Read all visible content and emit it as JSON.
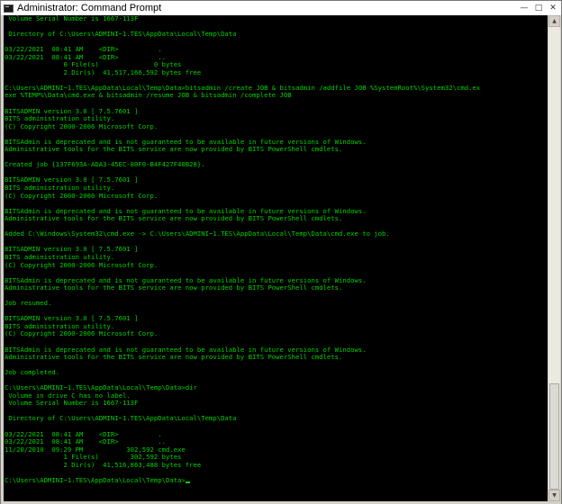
{
  "window": {
    "title": "Administrator: Command Prompt",
    "minimize_glyph": "—",
    "maximize_glyph": "□",
    "close_glyph": "✕"
  },
  "console": {
    "text_color": "#00d200",
    "background_color": "#000000",
    "lines": [
      " Volume Serial Number is 1667-113F",
      "",
      " Directory of C:\\Users\\ADMINI~1.TES\\AppData\\Local\\Temp\\Data",
      "",
      "03/22/2021  08:41 AM    <DIR>          .",
      "03/22/2021  08:41 AM    <DIR>          ..",
      "               0 File(s)              0 bytes",
      "               2 Dir(s)  41,517,166,592 bytes free",
      "",
      "C:\\Users\\ADMINI~1.TES\\AppData\\Local\\Temp\\Data>bitsadmin /create JOB & bitsadmin /addfile JOB %SystemRoot%\\System32\\cmd.ex",
      "exe %TEMP%\\Data\\cmd.exe & bitsadmin /resume JOB & bitsadmin /complete JOB",
      "",
      "BITSADMIN version 3.0 [ 7.5.7601 ]",
      "BITS administration utility.",
      "(C) Copyright 2000-2006 Microsoft Corp.",
      "",
      "BITSAdmin is deprecated and is not guaranteed to be available in future versions of Windows.",
      "Administrative tools for the BITS service are now provided by BITS PowerShell cmdlets.",
      "",
      "Created job {137F693A-ADA3-45EC-80F0-B4F427F40B28}.",
      "",
      "BITSADMIN version 3.0 [ 7.5.7601 ]",
      "BITS administration utility.",
      "(C) Copyright 2000-2006 Microsoft Corp.",
      "",
      "BITSAdmin is deprecated and is not guaranteed to be available in future versions of Windows.",
      "Administrative tools for the BITS service are now provided by BITS PowerShell cmdlets.",
      "",
      "Added C:\\Windows\\System32\\cmd.exe -> C:\\Users\\ADMINI~1.TES\\AppData\\Local\\Temp\\Data\\cmd.exe to job.",
      "",
      "BITSADMIN version 3.0 [ 7.5.7601 ]",
      "BITS administration utility.",
      "(C) Copyright 2000-2006 Microsoft Corp.",
      "",
      "BITSAdmin is deprecated and is not guaranteed to be available in future versions of Windows.",
      "Administrative tools for the BITS service are now provided by BITS PowerShell cmdlets.",
      "",
      "Job resumed.",
      "",
      "BITSADMIN version 3.0 [ 7.5.7601 ]",
      "BITS administration utility.",
      "(C) Copyright 2000-2006 Microsoft Corp.",
      "",
      "BITSAdmin is deprecated and is not guaranteed to be available in future versions of Windows.",
      "Administrative tools for the BITS service are now provided by BITS PowerShell cmdlets.",
      "",
      "Job completed.",
      "",
      "C:\\Users\\ADMINI~1.TES\\AppData\\Local\\Temp\\Data>dir",
      " Volume in drive C has no label.",
      " Volume Serial Number is 1667-113F",
      "",
      " Directory of C:\\Users\\ADMINI~1.TES\\AppData\\Local\\Temp\\Data",
      "",
      "03/22/2021  08:41 AM    <DIR>          .",
      "03/22/2021  08:41 AM    <DIR>          ..",
      "11/20/2010  09:29 PM           302,592 cmd.exe",
      "               1 File(s)        302,592 bytes",
      "               2 Dir(s)  41,516,863,488 bytes free",
      "",
      "C:\\Users\\ADMINI~1.TES\\AppData\\Local\\Temp\\Data>"
    ]
  },
  "scrollbar": {
    "up_glyph": "▲",
    "down_glyph": "▼"
  }
}
